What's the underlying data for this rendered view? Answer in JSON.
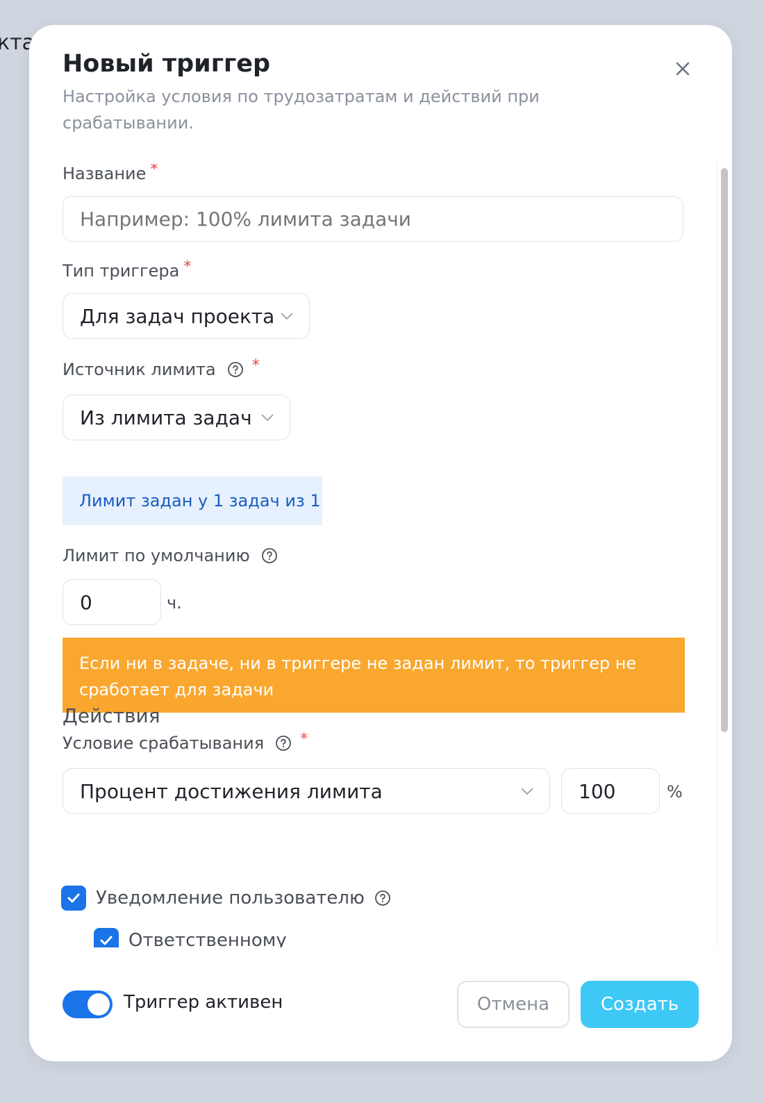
{
  "background": {
    "peek_text": "кта"
  },
  "modal": {
    "title": "Новый триггер",
    "subtitle": "Настройка условия по трудозатратам и действий при срабатывании."
  },
  "form": {
    "name": {
      "label": "Название",
      "required_mark": "*",
      "value": "",
      "placeholder": "Например: 100% лимита задачи"
    },
    "trigger_type": {
      "label": "Тип триггера",
      "required_mark": "*",
      "selected": "Для задач проекта"
    },
    "limit_source": {
      "label": "Источник лимита",
      "required_mark": "*",
      "selected": "Из лимита задач"
    },
    "limit_info": "Лимит задан у 1 задач из 1",
    "default_limit": {
      "label": "Лимит по умолчанию",
      "value": "0",
      "unit": "ч."
    },
    "warning": "Если ни в задаче, ни в триггере не задан лимит, то триггер не сработает для задачи",
    "condition": {
      "label": "Условие срабатывания",
      "required_mark": "*",
      "selected": "Процент достижения лимита",
      "value": "100",
      "unit": "%"
    },
    "actions": {
      "title": "Действия",
      "notify_user": {
        "label": "Уведомление пользователю",
        "checked": true
      },
      "responsible": {
        "label": "Ответственному",
        "checked": true
      }
    }
  },
  "footer": {
    "active_label": "Триггер активен",
    "active": true,
    "cancel": "Отмена",
    "create": "Создать"
  },
  "colors": {
    "primary": "#1a73e8",
    "create_button": "#3ec8f5",
    "warning_bg": "#f9a72f",
    "info_bg": "#e6f1fd",
    "info_text": "#1a5bc4",
    "required": "#e5484d"
  }
}
